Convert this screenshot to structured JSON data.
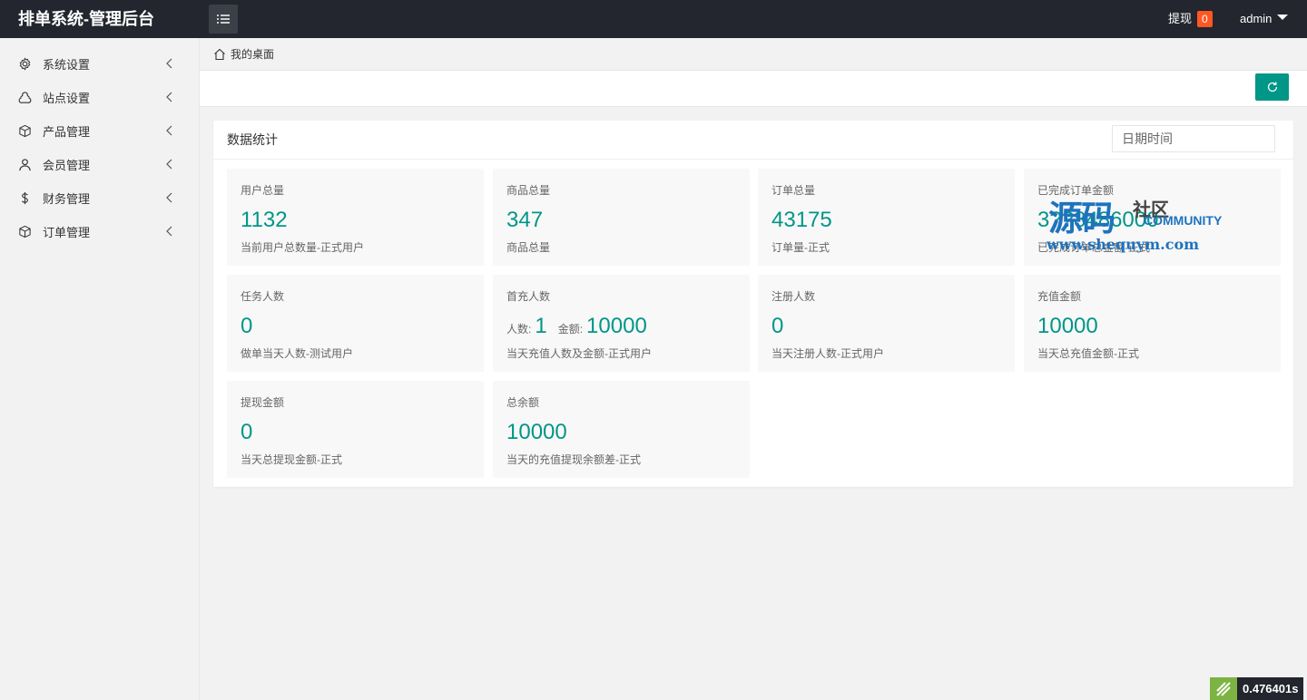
{
  "header": {
    "brand": "排单系统-管理后台",
    "menu_toggle_icon": "list-icon",
    "withdraw_label": "提现",
    "withdraw_count": "0",
    "username": "admin"
  },
  "sidebar": {
    "items": [
      {
        "label": "系统设置",
        "icon": "gear-icon"
      },
      {
        "label": "站点设置",
        "icon": "site-icon"
      },
      {
        "label": "产品管理",
        "icon": "box-icon"
      },
      {
        "label": "会员管理",
        "icon": "user-icon"
      },
      {
        "label": "财务管理",
        "icon": "dollar-icon"
      },
      {
        "label": "订单管理",
        "icon": "box-icon"
      }
    ]
  },
  "breadcrumb": {
    "home": "我的桌面"
  },
  "card": {
    "title": "数据统计",
    "date_placeholder": "日期时间",
    "stats": [
      {
        "title": "用户总量",
        "value": "1132",
        "desc": "当前用户总数量-正式用户"
      },
      {
        "title": "商品总量",
        "value": "347",
        "desc": "商品总量"
      },
      {
        "title": "订单总量",
        "value": "43175",
        "desc": "订单量-正式"
      },
      {
        "title": "已完成订单金额",
        "value": "3??8486000",
        "desc": "已完成订单总金额-正式"
      },
      {
        "title": "任务人数",
        "value": "0",
        "desc": "做单当天人数-测试用户"
      },
      {
        "title": "首充人数",
        "people_label": "人数:",
        "people_value": "1",
        "amount_label": "金额:",
        "amount_value": "10000",
        "desc": "当天充值人数及金额-正式用户"
      },
      {
        "title": "注册人数",
        "value": "0",
        "desc": "当天注册人数-正式用户"
      },
      {
        "title": "充值金额",
        "value": "10000",
        "desc": "当天总充值金额-正式"
      },
      {
        "title": "提现金额",
        "value": "0",
        "desc": "当天总提现金额-正式"
      },
      {
        "title": "总余额",
        "value": "10000",
        "desc": "当天的充值提现余额差-正式"
      }
    ]
  },
  "watermark": {
    "big": "源码",
    "small": "社区",
    "community": "COMMUNITY",
    "url": "www.shequym.com"
  },
  "timer": {
    "value": "0.476401s"
  },
  "colors": {
    "accent": "#009688",
    "header_bg": "#23262e",
    "badge": "#ff5722"
  }
}
